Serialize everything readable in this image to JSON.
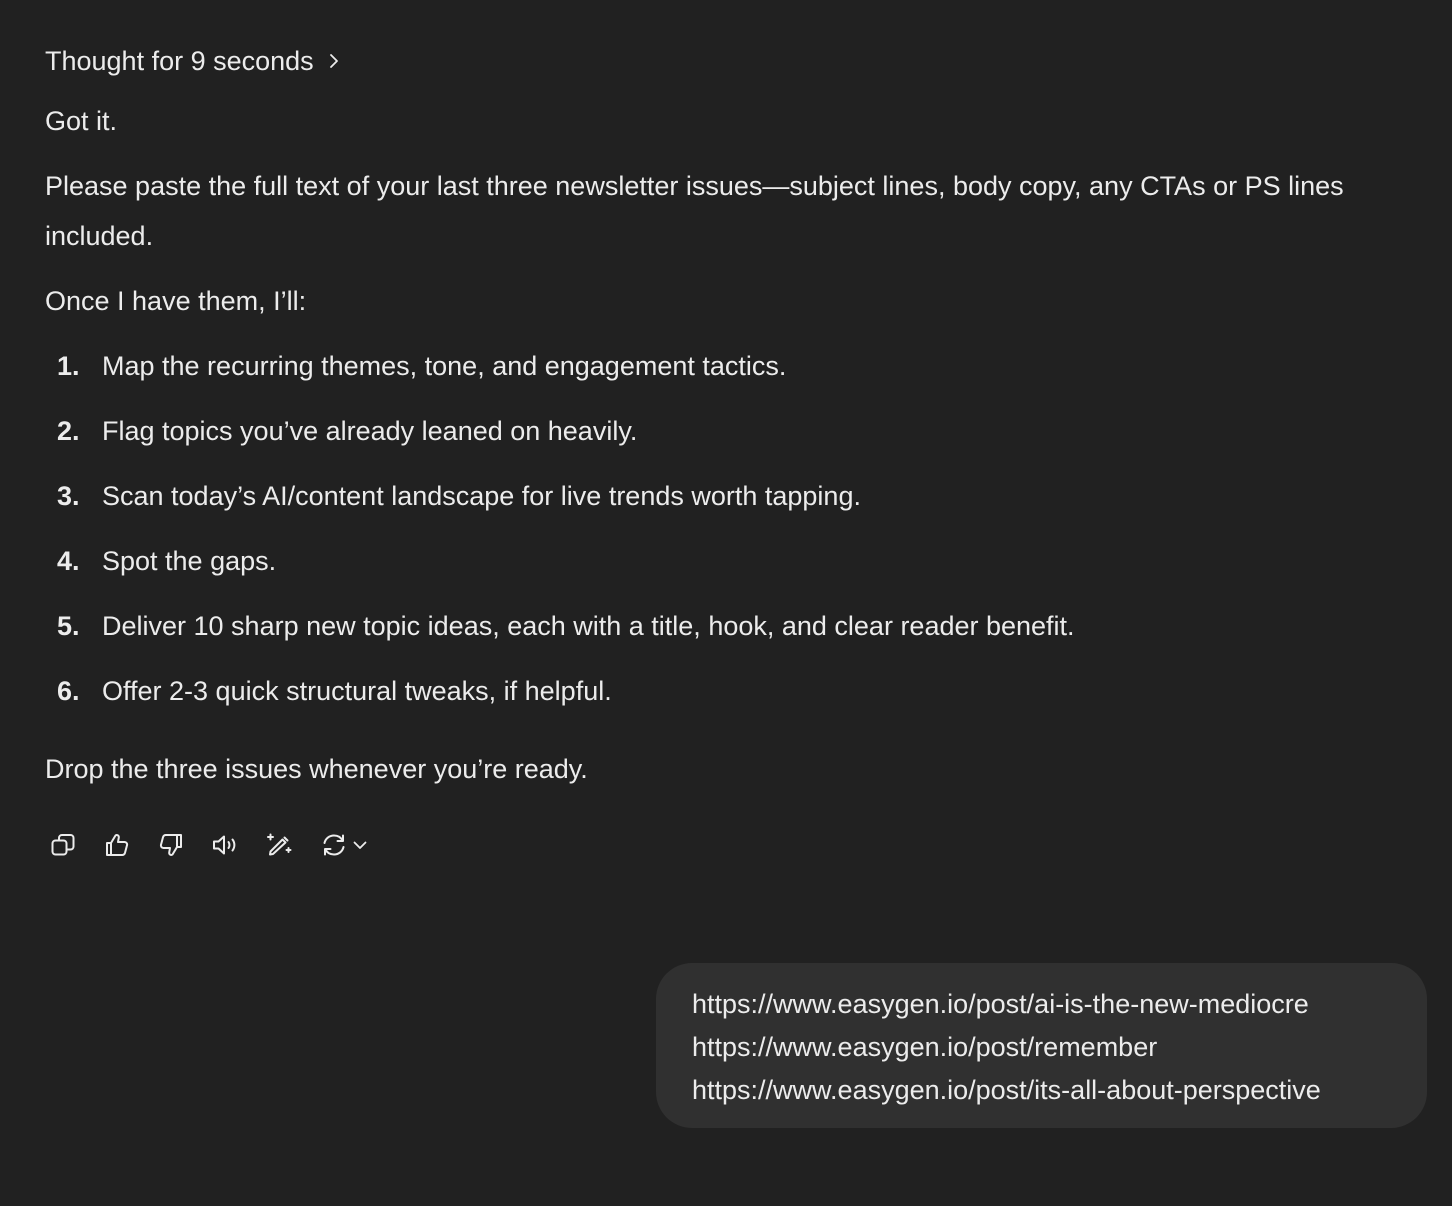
{
  "assistant": {
    "thought_label": "Thought for 9 seconds",
    "p1": "Got it.",
    "p2": "Please paste the full text of your last three newsletter issues—subject lines, body copy, any CTAs or PS lines included.",
    "p3": "Once I have them, I’ll:",
    "steps": [
      {
        "num": "1.",
        "text": "Map the recurring themes, tone, and engagement tactics."
      },
      {
        "num": "2.",
        "text": "Flag topics you’ve already leaned on heavily."
      },
      {
        "num": "3.",
        "text": "Scan today’s AI/content landscape for live trends worth tapping."
      },
      {
        "num": "4.",
        "text": "Spot the gaps."
      },
      {
        "num": "5.",
        "text": "Deliver 10 sharp new topic ideas, each with a title, hook, and clear reader benefit."
      },
      {
        "num": "6.",
        "text": "Offer 2-3 quick structural tweaks, if helpful."
      }
    ],
    "p4": "Drop the three issues whenever you’re ready.",
    "actions": [
      "copy-icon",
      "thumbs-up-icon",
      "thumbs-down-icon",
      "read-aloud-icon",
      "edit-in-canvas-icon",
      "regenerate-icon"
    ]
  },
  "user_message": {
    "lines": [
      "https://www.easygen.io/post/ai-is-the-new-mediocre",
      "https://www.easygen.io/post/remember",
      "https://www.easygen.io/post/its-all-about-perspective"
    ]
  },
  "colors": {
    "background": "#212121",
    "text": "#ececec",
    "bubble": "#303030"
  }
}
